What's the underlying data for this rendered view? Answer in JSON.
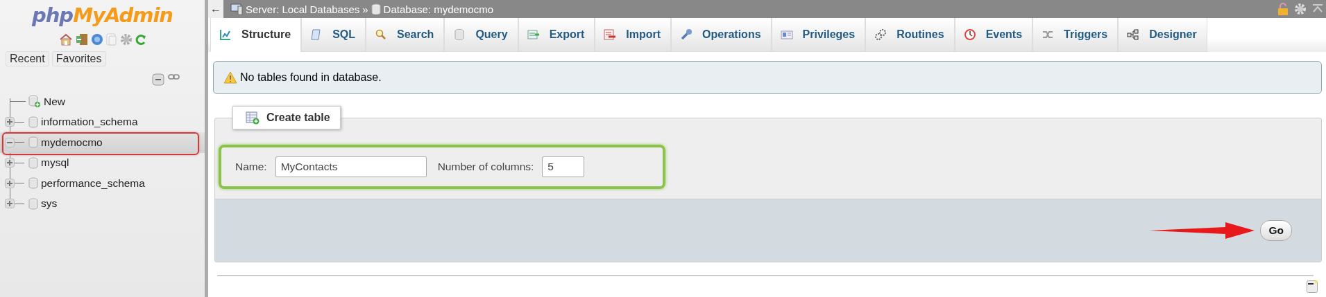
{
  "sidebar": {
    "logo": [
      "php",
      "MyAdmin"
    ],
    "nav_tabs": [
      {
        "label": "Recent"
      },
      {
        "label": "Favorites"
      }
    ],
    "tree": [
      {
        "kind": "new",
        "label": "New"
      },
      {
        "kind": "database",
        "label": "information_schema",
        "expanded": false,
        "selected": false
      },
      {
        "kind": "database",
        "label": "mydemocmo",
        "expanded": true,
        "selected": true
      },
      {
        "kind": "database",
        "label": "mysql",
        "expanded": false,
        "selected": false
      },
      {
        "kind": "database",
        "label": "performance_schema",
        "expanded": false,
        "selected": false
      },
      {
        "kind": "database",
        "label": "sys",
        "expanded": false,
        "selected": false
      }
    ]
  },
  "top_bar": {
    "back": "←",
    "breadcrumb": [
      "Server: Local Databases",
      "»",
      "Database: mydemocmo"
    ]
  },
  "tabs": [
    {
      "label": "Structure",
      "selected": true
    },
    {
      "label": "SQL",
      "selected": false
    },
    {
      "label": "Search",
      "selected": false
    },
    {
      "label": "Query",
      "selected": false
    },
    {
      "label": "Export",
      "selected": false
    },
    {
      "label": "Import",
      "selected": false
    },
    {
      "label": "Operations",
      "selected": false
    },
    {
      "label": "Privileges",
      "selected": false
    },
    {
      "label": "Routines",
      "selected": false
    },
    {
      "label": "Events",
      "selected": false
    },
    {
      "label": "Triggers",
      "selected": false
    },
    {
      "label": "Designer",
      "selected": false
    }
  ],
  "notice": "No tables found in database.",
  "create_table": {
    "legend": "Create table",
    "name_label": "Name:",
    "name_value": "MyContacts",
    "columns_label": "Number of columns:",
    "columns_value": "5",
    "go": "Go"
  }
}
